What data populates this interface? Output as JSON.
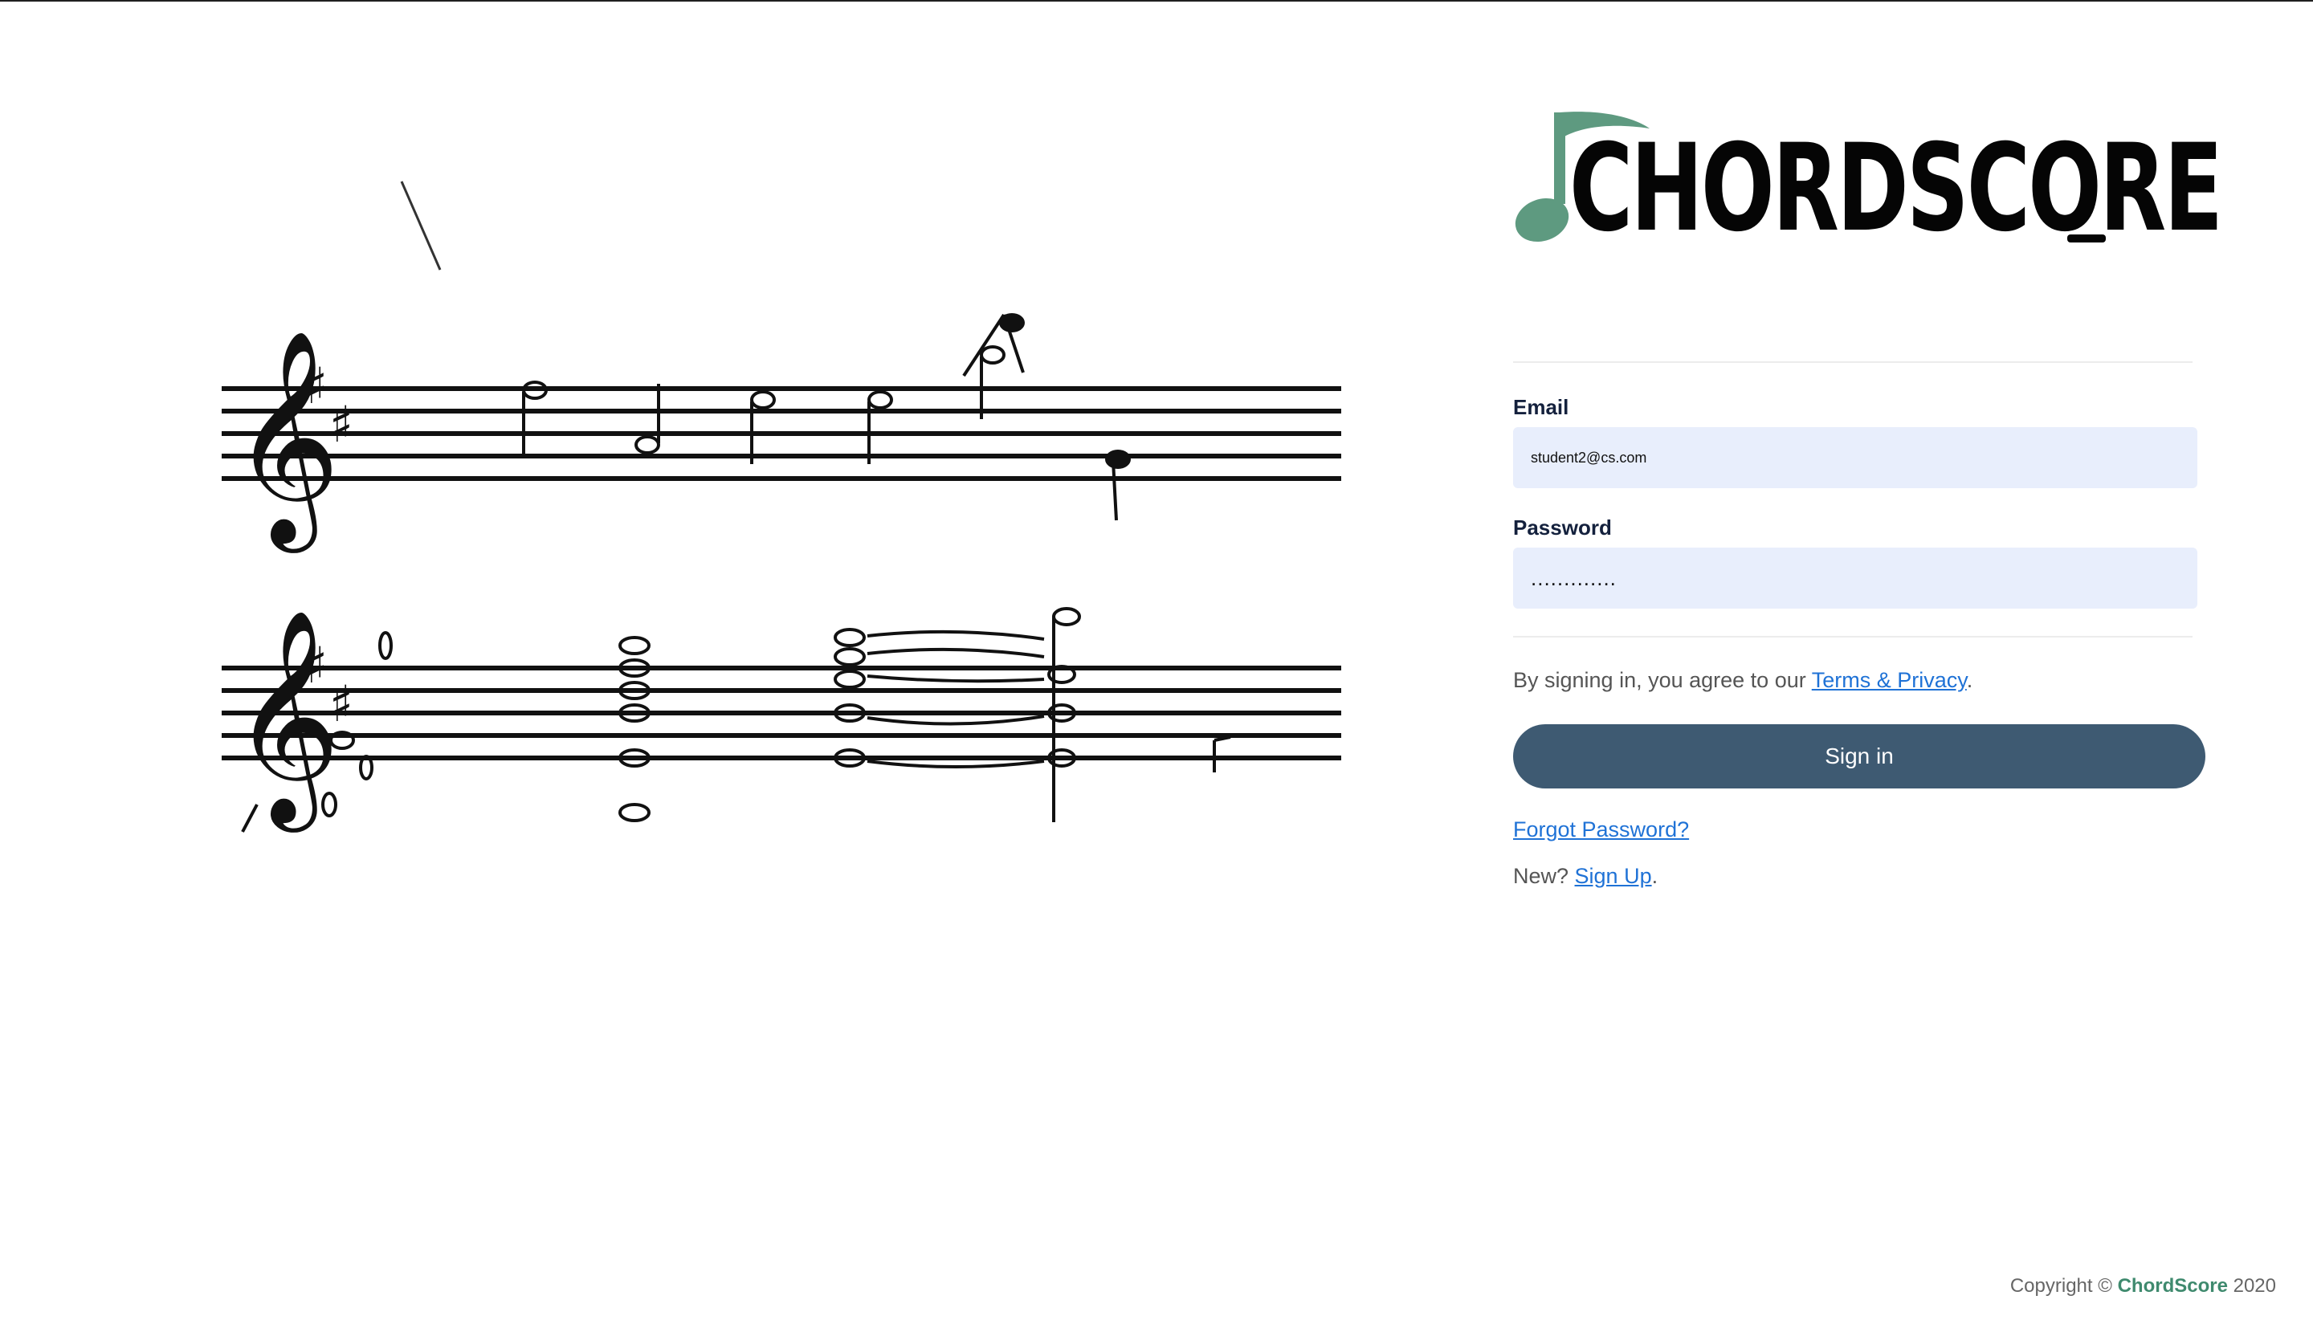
{
  "brand": {
    "logo_text": "CHORDSCORE",
    "logo_color": "#5e9a80"
  },
  "login": {
    "email_label": "Email",
    "email_value": "student2@cs.com",
    "password_label": "Password",
    "password_value": ".............",
    "terms_prefix": "By signing in, you agree to our ",
    "terms_link": "Terms & Privacy",
    "terms_suffix": ".",
    "signin_label": "Sign in",
    "forgot_link": "Forgot Password?",
    "signup_prefix": "New? ",
    "signup_link": "Sign Up",
    "signup_suffix": "."
  },
  "footer": {
    "copyright_prefix": "Copyright © ",
    "brand": "ChordScore",
    "year": " 2020"
  },
  "colors": {
    "input_bg": "#e8eefc",
    "button_bg": "#3e5a72",
    "link": "#1f72d6",
    "label": "#14213d"
  }
}
